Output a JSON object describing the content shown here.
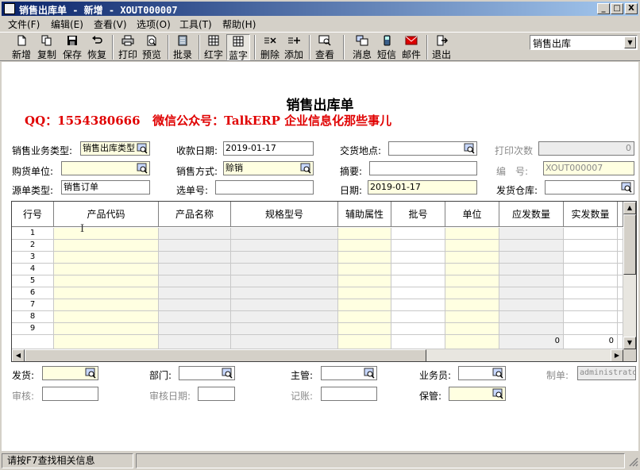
{
  "window": {
    "title": "销售出库单 - 新增 - XOUT000007",
    "controls": [
      "_",
      "□",
      "X"
    ]
  },
  "menu": [
    "文件(F)",
    "编辑(E)",
    "查看(V)",
    "选项(O)",
    "工具(T)",
    "帮助(H)"
  ],
  "toolbar": {
    "buttons": [
      {
        "label": "新增",
        "icon": "new-document-icon"
      },
      {
        "label": "复制",
        "icon": "copy-icon"
      },
      {
        "label": "保存",
        "icon": "floppy-disk-icon"
      },
      {
        "label": "恢复",
        "icon": "undo-icon"
      },
      {
        "label": "打印",
        "icon": "printer-icon"
      },
      {
        "label": "预览",
        "icon": "print-preview-icon"
      },
      {
        "label": "批录",
        "icon": "batch-entry-icon"
      },
      {
        "label": "红字",
        "icon": "red-grid-icon"
      },
      {
        "label": "蓝字",
        "icon": "blue-grid-icon"
      },
      {
        "label": "删除",
        "icon": "delete-row-icon"
      },
      {
        "label": "添加",
        "icon": "add-row-icon"
      },
      {
        "label": "查看",
        "icon": "view-icon"
      },
      {
        "label": "消息",
        "icon": "message-icon"
      },
      {
        "label": "短信",
        "icon": "sms-phone-icon"
      },
      {
        "label": "邮件",
        "icon": "mail-icon"
      },
      {
        "label": "退出",
        "icon": "exit-door-icon"
      }
    ],
    "doc_type_select": "销售出库"
  },
  "form": {
    "heading": "销售出库单",
    "promo": "QQ：1554380666   微信公众号：TalkERP 企业信息化那些事儿",
    "labels": {
      "business_type": "销售业务类型:",
      "receipt_date": "收款日期:",
      "delivery_place": "交货地点:",
      "print_count": "打印次数",
      "buyer": "购货单位:",
      "sales_method": "销售方式:",
      "summary": "摘要:",
      "doc_no": "编　号:",
      "source_type": "源单类型:",
      "select_no": "选单号:",
      "date": "日期:",
      "warehouse": "发货仓库:"
    },
    "values": {
      "business_type": "销售出库类型",
      "receipt_date": "2019-01-17",
      "delivery_place": "",
      "print_count": "0",
      "buyer": "",
      "sales_method": "赊销",
      "summary": "",
      "doc_no": "XOUT000007",
      "source_type": "销售订单",
      "select_no": "",
      "date": "2019-01-17",
      "warehouse": ""
    }
  },
  "grid": {
    "columns": [
      "行号",
      "产品代码",
      "产品名称",
      "规格型号",
      "辅助属性",
      "批号",
      "单位",
      "应发数量",
      "实发数量"
    ],
    "rows": [
      "1",
      "2",
      "3",
      "4",
      "5",
      "6",
      "7",
      "8",
      "9"
    ],
    "totals": {
      "due_qty": "0",
      "actual_qty": "0"
    }
  },
  "footer": {
    "labels": {
      "shipper": "发货:",
      "department": "部门:",
      "supervisor": "主管:",
      "salesman": "业务员:",
      "maker": "制单:",
      "auditor": "审核:",
      "audit_date": "审核日期:",
      "bookkeeper": "记账:",
      "keeper": "保管:"
    },
    "values": {
      "maker": "administrato"
    }
  },
  "status": {
    "hint": "请按F7查找相关信息"
  }
}
